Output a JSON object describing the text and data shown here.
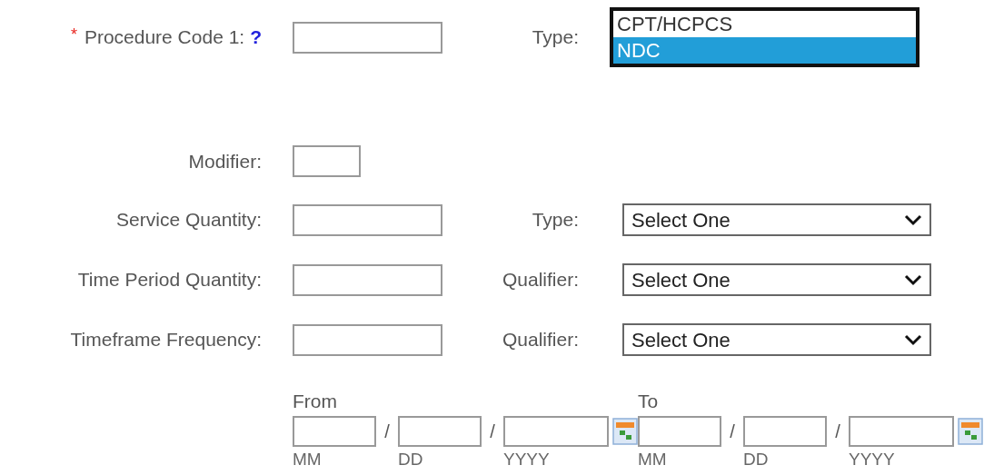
{
  "rows": [
    {
      "kind": "code",
      "required_mark": "*",
      "label": "Procedure Code 1:",
      "help": "?",
      "type_label": "Type:",
      "type_options": [
        {
          "label": "CPT/HCPCS",
          "selected": false
        },
        {
          "label": "NDC",
          "selected": true
        }
      ]
    },
    {
      "kind": "modifier",
      "label": "Modifier:"
    },
    {
      "kind": "quantity",
      "label": "Service Quantity:",
      "select_label": "Type:",
      "select_value": "Select One"
    },
    {
      "kind": "quantity",
      "label": "Time Period Quantity:",
      "select_label": "Qualifier:",
      "select_value": "Select One"
    },
    {
      "kind": "quantity",
      "label": "Timeframe Frequency:",
      "select_label": "Qualifier:",
      "select_value": "Select One"
    }
  ],
  "date_ranges": [
    {
      "label": "From",
      "separators": [
        "/",
        "/"
      ],
      "parts": [
        "MM",
        "DD",
        "YYYY"
      ]
    },
    {
      "label": "To",
      "separators": [
        "/",
        "/"
      ],
      "parts": [
        "MM",
        "DD",
        "YYYY"
      ]
    }
  ]
}
